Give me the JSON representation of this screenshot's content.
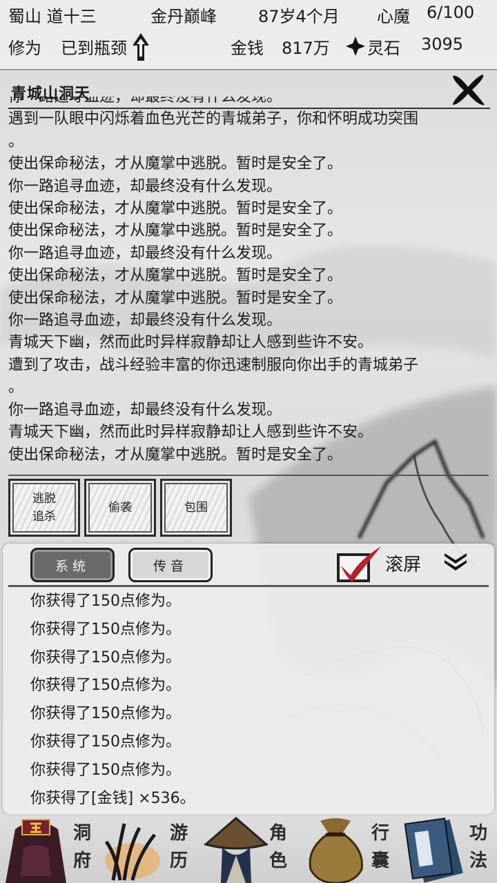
{
  "status": {
    "location": "蜀山 道十三",
    "realm": "金丹巅峰",
    "age": "87岁4个月",
    "heart_demon_label": "心魔",
    "heart_demon_value": "6/100",
    "cultivation_label": "修为",
    "cultivation_value": "已到瓶颈",
    "money_label": "金钱",
    "money_value": "817万",
    "spirit_stone_label": "灵石",
    "spirit_stone_value": "3095"
  },
  "event": {
    "title": "青城山洞天",
    "log": [
      "你一路追寻血迹，却最终没有什么发现。",
      "遇到一队眼中闪烁着血色光芒的青城弟子，你和怀明成功突围",
      "。",
      "使出保命秘法，才从魔掌中逃脱。暂时是安全了。",
      "你一路追寻血迹，却最终没有什么发现。",
      "使出保命秘法，才从魔掌中逃脱。暂时是安全了。",
      "使出保命秘法，才从魔掌中逃脱。暂时是安全了。",
      "你一路追寻血迹，却最终没有什么发现。",
      "使出保命秘法，才从魔掌中逃脱。暂时是安全了。",
      "使出保命秘法，才从魔掌中逃脱。暂时是安全了。",
      "你一路追寻血迹，却最终没有什么发现。",
      "青城天下幽，然而此时异样寂静却让人感到些许不安。",
      "遭到了攻击，战斗经验丰富的你迅速制服向你出手的青城弟子",
      "。",
      "你一路追寻血迹，却最终没有什么发现。",
      "青城天下幽，然而此时异样寂静却让人感到些许不安。",
      "使出保命秘法，才从魔掌中逃脱。暂时是安全了。"
    ],
    "actions": [
      "逃脱\n追杀",
      "偷袭",
      "包围"
    ]
  },
  "messages": {
    "tabs": [
      "系统",
      "传音"
    ],
    "active_tab": "系统",
    "scroll_lock_label": "滚屏",
    "scroll_lock_checked": true,
    "lines": [
      "你获得了150点修为。",
      "你获得了150点修为。",
      "你获得了150点修为。",
      "你获得了150点修为。",
      "你获得了150点修为。",
      "你获得了150点修为。",
      "你获得了150点修为。",
      "你获得了[金钱] ×536。"
    ]
  },
  "nav": {
    "items": [
      {
        "label": "洞府",
        "icon": "cave-dwelling-icon"
      },
      {
        "label": "游历",
        "icon": "travel-icon"
      },
      {
        "label": "角色",
        "icon": "character-icon"
      },
      {
        "label": "行囊",
        "icon": "bag-icon"
      },
      {
        "label": "功法",
        "icon": "skill-book-icon"
      }
    ],
    "active": "游历"
  },
  "colors": {
    "background": "#e0e0e0",
    "check_mark": "#b8202a",
    "active_tab": "#6a6a6a",
    "text": "#1d1d1d"
  }
}
